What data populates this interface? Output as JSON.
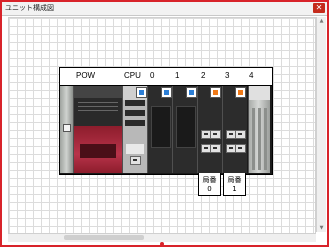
{
  "window": {
    "title": "ユニット構成図",
    "close_glyph": "✕"
  },
  "base": {
    "slots": [
      {
        "label": "POW"
      },
      {
        "label": "CPU"
      },
      {
        "label": "0"
      },
      {
        "label": "1"
      },
      {
        "label": "2"
      },
      {
        "label": "3"
      },
      {
        "label": "4"
      }
    ]
  },
  "stations": [
    {
      "label": "局番",
      "number": "0"
    },
    {
      "label": "局番",
      "number": "1"
    }
  ],
  "status_colors": {
    "blue_badge": "#2d7fd6",
    "orange_badge": "#f07a18",
    "window_border": "#d8232a"
  },
  "icons": {
    "scroll_up": "▲",
    "scroll_down": "▼"
  }
}
